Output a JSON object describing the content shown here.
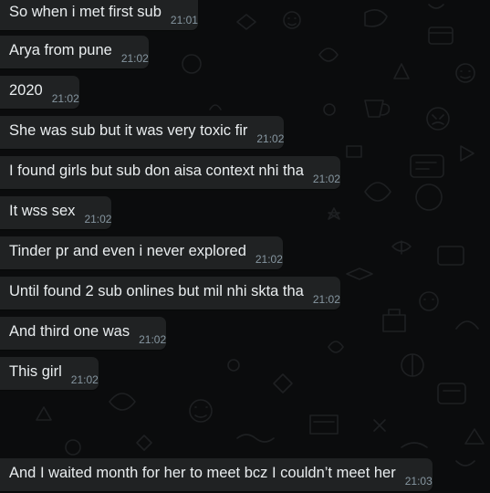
{
  "chat": {
    "messages": [
      {
        "text": "So when i met first sub",
        "time": "21:01"
      },
      {
        "text": "Arya from pune",
        "time": "21:02"
      },
      {
        "text": "2020",
        "time": "21:02"
      },
      {
        "text": "She was sub but it was very toxic fir",
        "time": "21:02"
      },
      {
        "text": "I found girls but sub don aisa context nhi tha",
        "time": "21:02"
      },
      {
        "text": "It wss sex",
        "time": "21:02"
      },
      {
        "text": "Tinder pr and even i never explored",
        "time": "21:02"
      },
      {
        "text": "Until found 2 sub onlines but mil nhi skta tha",
        "time": "21:02"
      },
      {
        "text": "And third one was",
        "time": "21:02"
      },
      {
        "text": "This girl",
        "time": "21:02"
      },
      {
        "text": "And I waited month for her to meet bcz I couldn’t meet her",
        "time": "21:03"
      }
    ]
  },
  "colors": {
    "wallpaper": "#0b0c0d",
    "bubble_incoming": "#202223",
    "message_text": "#e9edef",
    "timestamp_text": "#8696a0"
  }
}
